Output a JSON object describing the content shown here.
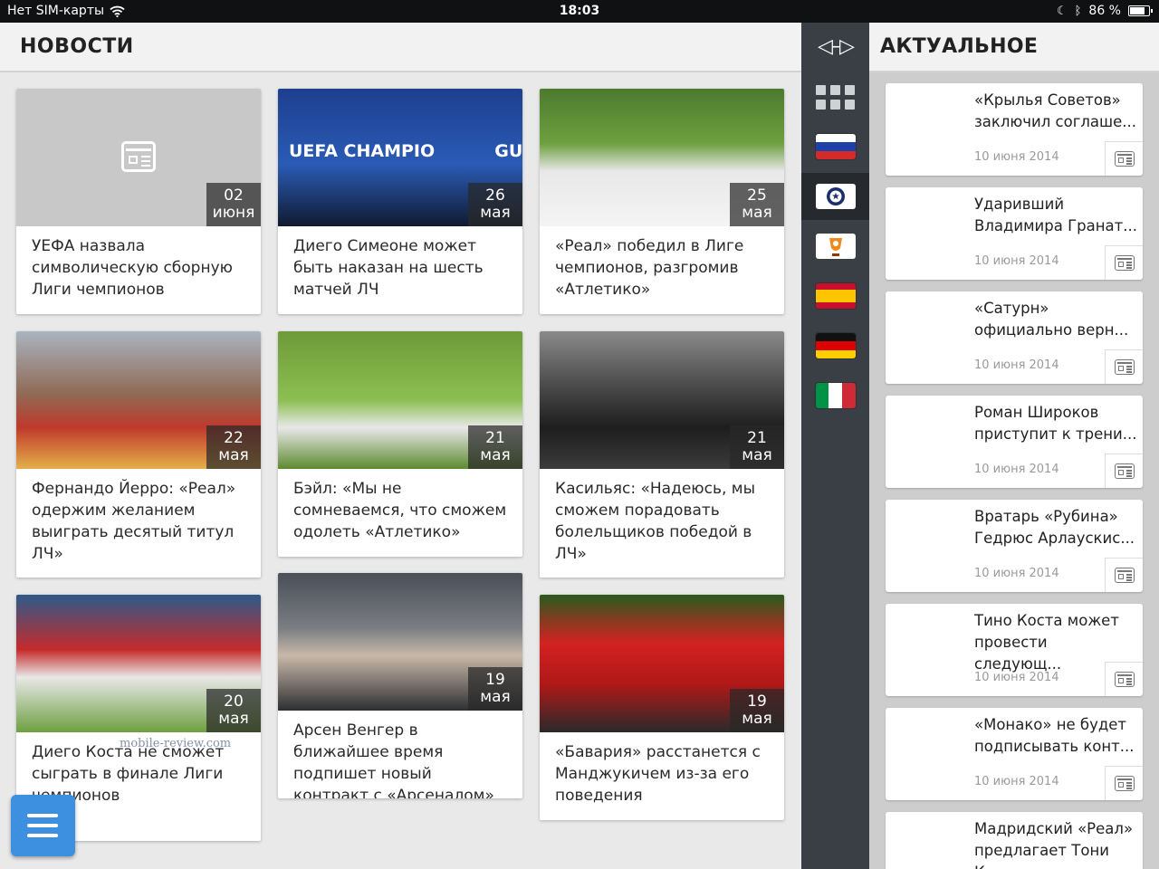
{
  "status_bar": {
    "carrier": "Нет SIM-карты",
    "time": "18:03",
    "battery": "86 %",
    "battery_level": 0.86
  },
  "news": {
    "title": "НОВОСТИ",
    "cards": [
      {
        "day": "02",
        "month": "июня",
        "title": " УЕФА назвала символическую сборную Лиги чемпионов",
        "photo": "placeholder"
      },
      {
        "day": "26",
        "month": "мая",
        "title": "Диего Симеоне может быть наказан на шесть матчей ЛЧ",
        "photo": "uefa",
        "banner": "UEFA CHAMPIO          GUE"
      },
      {
        "day": "25",
        "month": "мая",
        "title": "«Реал» победил в Лиге чемпионов, разгромив «Атлетико»",
        "photo": "grass"
      },
      {
        "day": "22",
        "month": "мая",
        "title": "Фернандо Йерро: «Реал» одержим желанием выиграть десятый титул ЛЧ»",
        "photo": "stadium"
      },
      {
        "day": "21",
        "month": "мая",
        "title": "Бэйл: «Мы не сомневаемся, что сможем одолеть «Атлетико»",
        "photo": "grass2"
      },
      {
        "day": "21",
        "month": "мая",
        "title": "Касильяс: «Надеюсь, мы сможем порадовать болельщиков победой в ЛЧ»",
        "photo": "net"
      },
      {
        "day": "20",
        "month": "мая",
        "title": "Диего Коста не сможет сыграть в финале Лиги чемпионов",
        "photo": "red"
      },
      {
        "day": "19",
        "month": "мая",
        "title": "Арсен Венгер в ближайшее время подпишет новый контракт с «Арсеналом»",
        "photo": "grey"
      },
      {
        "day": "19",
        "month": "мая",
        "title": "«Бавария» расстанется с Манджукичем из-за его поведения",
        "photo": "bayern"
      }
    ]
  },
  "watermark": "mobile-review.com",
  "sidebar": {
    "toggle_icon": "arrows-expand-icon",
    "items": [
      {
        "name": "all-news",
        "icon": "grid-icon"
      },
      {
        "name": "russia",
        "icon": "flag-russia"
      },
      {
        "name": "champions-league",
        "icon": "champions-league-logo",
        "active": true
      },
      {
        "name": "europa-league",
        "icon": "europa-league-logo"
      },
      {
        "name": "spain",
        "icon": "flag-spain"
      },
      {
        "name": "germany",
        "icon": "flag-germany"
      },
      {
        "name": "italy",
        "icon": "flag-italy"
      }
    ]
  },
  "actual": {
    "title": "АКТУАЛЬНОЕ",
    "items": [
      {
        "title": "«Крылья Советов» заключил соглаше...",
        "date": "10 июня 2014"
      },
      {
        "title": "Ударивший Владимира Гранат...",
        "date": "10 июня 2014"
      },
      {
        "title": "«Сатурн» официально верн...",
        "date": "10 июня 2014"
      },
      {
        "title": "Роман Широков приступит к трени...",
        "date": "10 июня 2014"
      },
      {
        "title": " Вратарь «Рубина» Гедрюс Арлаускис...",
        "date": "10 июня 2014"
      },
      {
        "title": "Тино Коста может провести следующ...",
        "date": "10 июня 2014"
      },
      {
        "title": "«Монако» не будет подписывать конт...",
        "date": "10 июня 2014"
      },
      {
        "title": "Мадридский «Реал» предлагает Тони К...",
        "date": ""
      }
    ]
  },
  "colors": {
    "accent": "#3d8fe0",
    "sidebar": "#3a3f45",
    "sidebar_active": "#262a2e"
  }
}
